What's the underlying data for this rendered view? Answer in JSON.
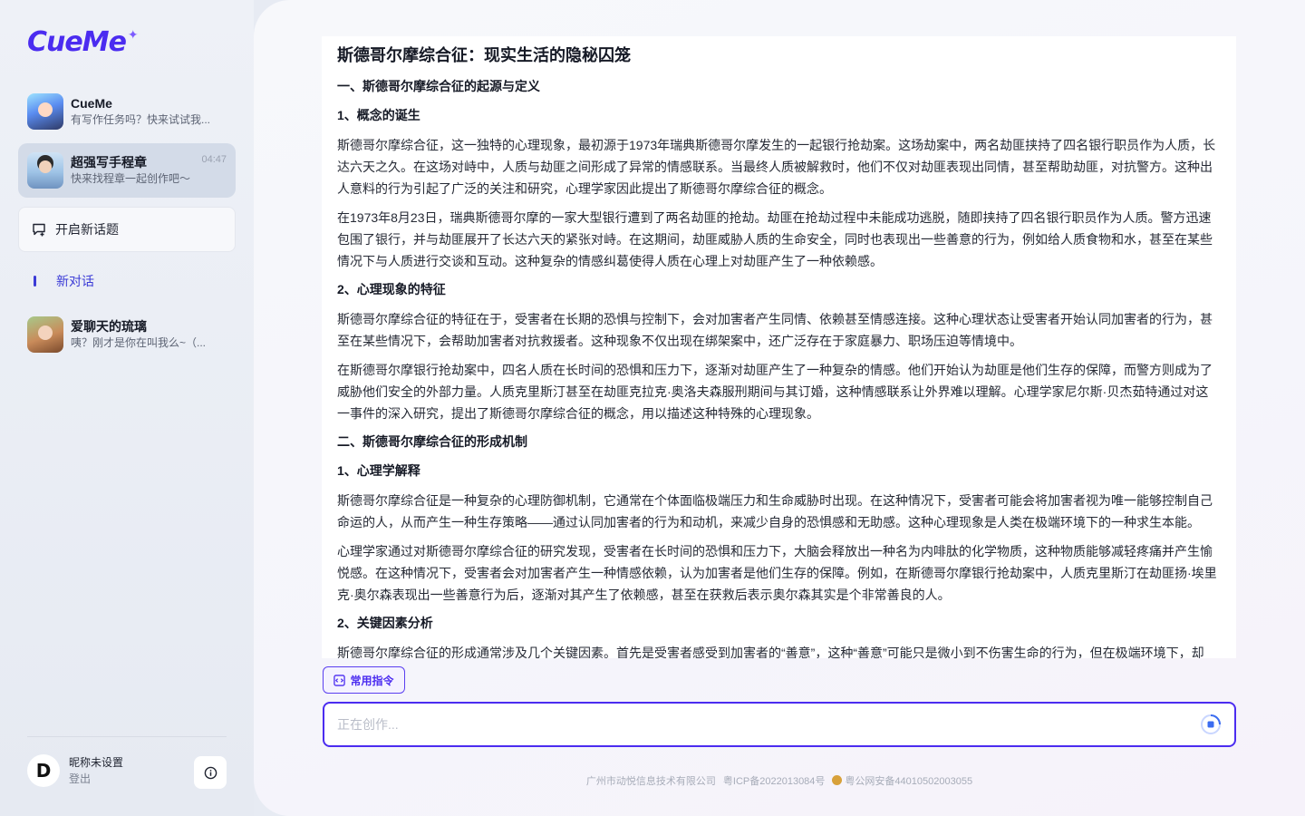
{
  "app": {
    "logo": "CueMe",
    "logo_star": "✦"
  },
  "sidebar": {
    "chats": [
      {
        "name": "CueMe",
        "preview": "有写作任务吗？快来试试我...",
        "time": "",
        "avatar": "cueme-avatar"
      },
      {
        "name": "超强写手程章",
        "preview": "快来找程章一起创作吧～",
        "time": "04:47",
        "avatar": "writer-avatar"
      }
    ],
    "new_topic_label": "开启新话题",
    "section_label": "新对话",
    "history": [
      {
        "name": "爱聊天的琉璃",
        "preview": "咦？刚才是你在叫我么~（...",
        "avatar": "liuli-avatar"
      }
    ],
    "user": {
      "avatar_letter": "D",
      "nickname": "昵称未设置",
      "logout": "登出"
    }
  },
  "document": {
    "title": "斯德哥尔摩综合征：现实生活的隐秘囚笼",
    "s1_heading": "一、斯德哥尔摩综合征的起源与定义",
    "s1_1_heading": "1、概念的诞生",
    "s1_1_p1": "斯德哥尔摩综合征，这一独特的心理现象，最初源于1973年瑞典斯德哥尔摩发生的一起银行抢劫案。这场劫案中，两名劫匪挟持了四名银行职员作为人质，长达六天之久。在这场对峙中，人质与劫匪之间形成了异常的情感联系。当最终人质被解救时，他们不仅对劫匪表现出同情，甚至帮助劫匪，对抗警方。这种出人意料的行为引起了广泛的关注和研究，心理学家因此提出了斯德哥尔摩综合征的概念。",
    "s1_1_p2": "在1973年8月23日，瑞典斯德哥尔摩的一家大型银行遭到了两名劫匪的抢劫。劫匪在抢劫过程中未能成功逃脱，随即挟持了四名银行职员作为人质。警方迅速包围了银行，并与劫匪展开了长达六天的紧张对峙。在这期间，劫匪威胁人质的生命安全，同时也表现出一些善意的行为，例如给人质食物和水，甚至在某些情况下与人质进行交谈和互动。这种复杂的情感纠葛使得人质在心理上对劫匪产生了一种依赖感。",
    "s1_2_heading": "2、心理现象的特征",
    "s1_2_p1": "斯德哥尔摩综合征的特征在于，受害者在长期的恐惧与控制下，会对加害者产生同情、依赖甚至情感连接。这种心理状态让受害者开始认同加害者的行为，甚至在某些情况下，会帮助加害者对抗救援者。这种现象不仅出现在绑架案中，还广泛存在于家庭暴力、职场压迫等情境中。",
    "s1_2_p2": "在斯德哥尔摩银行抢劫案中，四名人质在长时间的恐惧和压力下，逐渐对劫匪产生了一种复杂的情感。他们开始认为劫匪是他们生存的保障，而警方则成为了威胁他们安全的外部力量。人质克里斯汀甚至在劫匪克拉克·奥洛夫森服刑期间与其订婚，这种情感联系让外界难以理解。心理学家尼尔斯·贝杰茹特通过对这一事件的深入研究，提出了斯德哥尔摩综合征的概念，用以描述这种特殊的心理现象。",
    "s2_heading": "二、斯德哥尔摩综合征的形成机制",
    "s2_1_heading": "1、心理学解释",
    "s2_1_p1": "斯德哥尔摩综合征是一种复杂的心理防御机制，它通常在个体面临极端压力和生命威胁时出现。在这种情况下，受害者可能会将加害者视为唯一能够控制自己命运的人，从而产生一种生存策略——通过认同加害者的行为和动机，来减少自身的恐惧感和无助感。这种心理现象是人类在极端环境下的一种求生本能。",
    "s2_1_p2": "心理学家通过对斯德哥尔摩综合征的研究发现，受害者在长时间的恐惧和压力下，大脑会释放出一种名为内啡肽的化学物质，这种物质能够减轻疼痛并产生愉悦感。在这种情况下，受害者会对加害者产生一种情感依赖，认为加害者是他们生存的保障。例如，在斯德哥尔摩银行抢劫案中，人质克里斯汀在劫匪扬·埃里克·奥尔森表现出一些善意行为后，逐渐对其产生了依赖感，甚至在获救后表示奥尔森其实是个非常善良的人。",
    "s2_2_heading": "2、关键因素分析",
    "s2_2_p1": "斯德哥尔摩综合征的形成通常涉及几个关键因素。首先是受害者感受到加害者的“善意”，这种“善意”可能只是微小到不伤害生命的行为，但在极端环境下，却"
  },
  "composer": {
    "commands_label": "常用指令",
    "input_placeholder": "正在创作...",
    "input_value": ""
  },
  "footer": {
    "company": "广州市动悦信息技术有限公司",
    "icp": "粤ICP备2022013084号",
    "police": "粤公网安备44010502003055"
  },
  "colors": {
    "accent": "#4b2cf0",
    "active_item": "#d3dbe8"
  }
}
